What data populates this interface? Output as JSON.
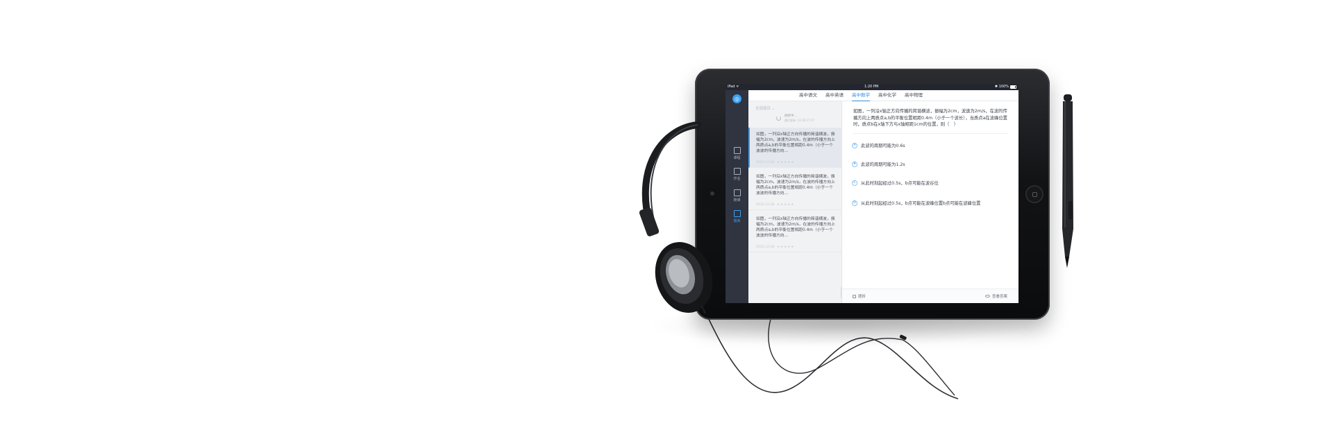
{
  "colors": {
    "accent": "#2f8fe0",
    "nav_bg": "#2f3440",
    "list_bg": "#f1f2f4",
    "device_body": "#121315"
  },
  "statusbar": {
    "carrier": "iPad ᯤ",
    "time": "1:20 PM",
    "battery": "✱ 100%"
  },
  "nav": {
    "logo_icon": "globe-logo",
    "items": [
      {
        "label": "课程",
        "icon": "calendar-icon",
        "active": false
      },
      {
        "label": "作业",
        "icon": "homework-icon",
        "active": false
      },
      {
        "label": "随课",
        "icon": "class-icon",
        "active": false
      },
      {
        "label": "题库",
        "icon": "question-bank-icon",
        "active": true
      }
    ]
  },
  "tabs": [
    {
      "label": "高中语文",
      "active": false
    },
    {
      "label": "高中英语",
      "active": false
    },
    {
      "label": "高中数学",
      "active": true
    },
    {
      "label": "高中化学",
      "active": false
    },
    {
      "label": "高中物理",
      "active": false
    }
  ],
  "question_list": {
    "header": "全部题目 ⌄",
    "loading": {
      "text": "刷新中...",
      "subtext": "最后更新: 12-28 17:57"
    },
    "items": [
      {
        "text": "如图，一列沿x轴正方向传播的简谐横波，振幅为2cm，波速为2m/s，在波的传播方向上两质点a,b的平衡位置相距0.4m（小于一个波波的传播方向...",
        "meta": "2015-12-28",
        "stars": "★★★★★",
        "selected": true
      },
      {
        "text": "如图，一列沿x轴正方向传播的简谐横波，振幅为2cm，波速为2m/s，在波的传播方向上两质点a,b的平衡位置相距0.4m（小于一个波波的传播方向...",
        "meta": "2015-12-28",
        "stars": "★★★★★",
        "selected": false
      },
      {
        "text": "如图，一列沿x轴正方向传播的简谐横波，振幅为2cm，波速为2m/s，在波的传播方向上两质点a,b的平衡位置相距0.4m（小于一个波波的传播方向...",
        "meta": "2015-12-28",
        "stars": "★★★★★",
        "selected": false
      }
    ]
  },
  "detail": {
    "stem": "如图，一列沿x轴正方向传播的简谐横波，振幅为2cm，波速为2m/s，在波的传播方向上两质点a,b的平衡位置相距0.4m（小于一个波长），当质点a在波峰位置时，质点b在x轴下方与x轴相距1cm的位置，则（　）",
    "options": [
      {
        "letter": "A",
        "text": "此波的周期可能为0.6s"
      },
      {
        "letter": "B",
        "text": "此波的周期可能为1.2s"
      },
      {
        "letter": "C",
        "text": "从此时刻起经过0.5s，b点可能在波谷位"
      },
      {
        "letter": "D",
        "text": "从此时刻起经过0.5s，b点可能在波峰位置b点可能在波峰位置"
      }
    ],
    "footer": {
      "left_label": "题析",
      "right_label": "查看答案"
    }
  }
}
